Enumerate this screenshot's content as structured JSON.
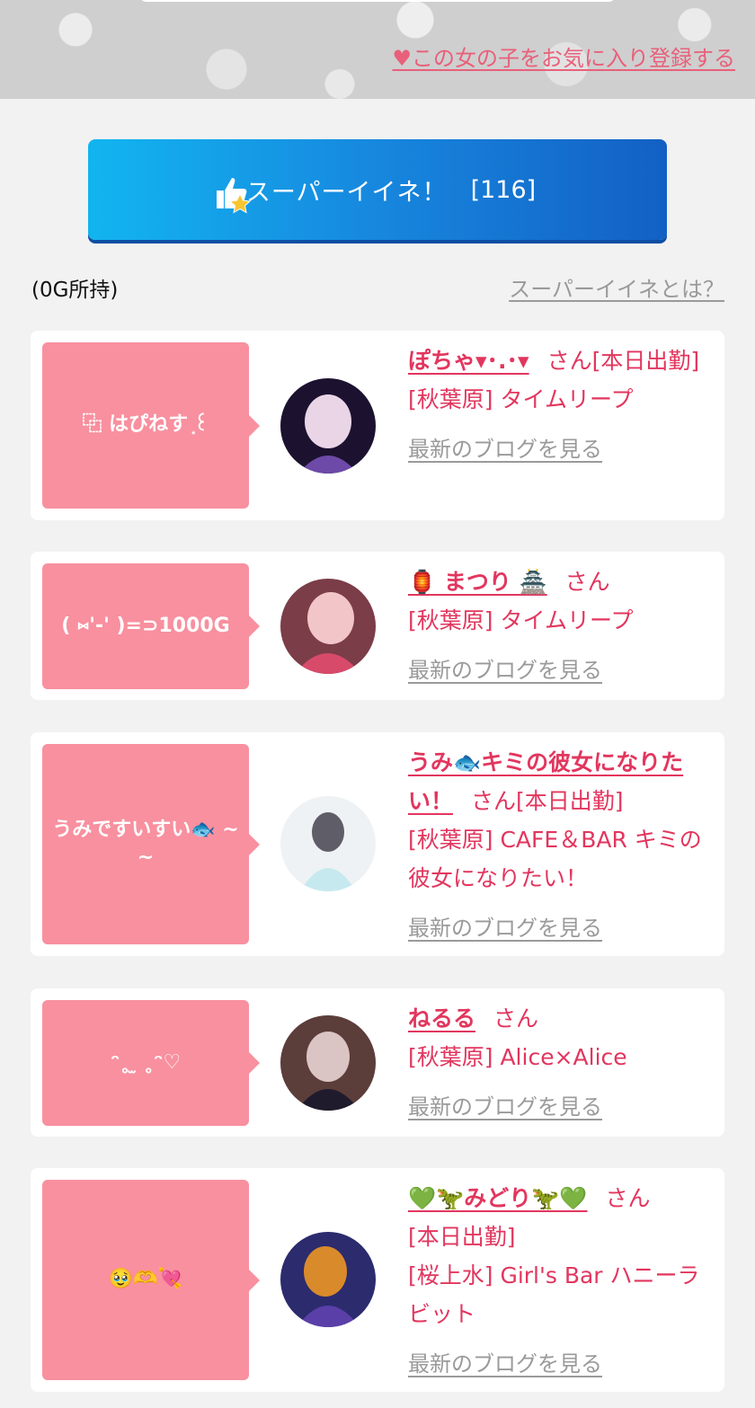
{
  "header": {
    "favorite_link": "♥この女の子をお気に入り登録する"
  },
  "super_like": {
    "label": "スーパーイイネ！",
    "count": "[116]"
  },
  "owned": "(0G所持)",
  "about_link": "スーパーイイネとは？",
  "blog_link": "最新のブログを見る",
  "entries": [
    {
      "message": "⿻ はぴねす ͙꒰",
      "name": "ぽちゃ▾･.･▾",
      "suffix": "さん",
      "today": "[本日出勤]",
      "shop": "[秋葉原] タイムリープ",
      "avatar_colors": [
        "#1c1230",
        "#6d4aa8",
        "#e9d5e6"
      ]
    },
    {
      "message": "( ⑅'-' )=⊃1000G",
      "name": "🏮 まつり 🏯",
      "suffix": "さん",
      "today": "",
      "shop": "[秋葉原] タイムリープ",
      "avatar_colors": [
        "#d84a6a",
        "#f2c5c8",
        "#7b3d48"
      ]
    },
    {
      "message": "うみですいすい🐟 ~ ~",
      "name": "うみ🐟キミの彼女になりたい！",
      "suffix": "さん",
      "today": "[本日出勤]",
      "shop": "[秋葉原] CAFE＆BAR キミの彼女になりたい！",
      "avatar_colors": [
        "#eef2f4",
        "#c6e9ef",
        "#5e5d68"
      ]
    },
    {
      "message": "ᵔ˳ ̫ ˳ᵔ♡",
      "name": "ねるる",
      "suffix": "さん",
      "today": "",
      "shop": "[秋葉原] Alice×Alice",
      "avatar_colors": [
        "#5b3d3a",
        "#dbc4c4",
        "#201b2c"
      ]
    },
    {
      "message": "🥹🫶💘",
      "name": "💚🦖みどり🦖💚",
      "suffix": "さん",
      "today": "[本日出勤]",
      "shop": "[桜上水] Girl's Bar ハニーラビット",
      "avatar_colors": [
        "#2b2b6e",
        "#d98a2b",
        "#5b3fa8"
      ]
    }
  ]
}
